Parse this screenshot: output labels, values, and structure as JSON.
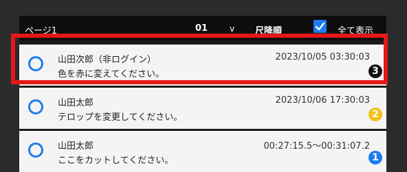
{
  "header": {
    "page_label": "ページ1",
    "page_number": "01",
    "dropdown_chevron": "v",
    "sort_label": "尺降順",
    "show_all_label": "全て表示",
    "show_all_checked": true
  },
  "comments": [
    {
      "name": "山田次郎（非ログイン）",
      "timestamp": "2023/10/05 03:30:03",
      "message": "色を赤に変えてください。",
      "badge": "3",
      "badge_color": "#111111",
      "badge_glyph": "❸"
    },
    {
      "name": "山田太郎",
      "timestamp": "2023/10/06 17:30:03",
      "message": "テロップを変更してください。",
      "badge": "2",
      "badge_color": "#f2c21a",
      "badge_glyph": "2"
    },
    {
      "name": "山田太郎",
      "timestamp": "00:27:15.5〜00:31:07.2",
      "message": "ここをカットしてください。",
      "badge": "1",
      "badge_color": "#1e7cf0",
      "badge_glyph": "1"
    }
  ],
  "colors": {
    "accent": "#1e7cf0",
    "highlight_frame": "#e5171a"
  },
  "icons": {
    "checkbox": "checkmark-icon",
    "row_marker": "circle-icon"
  }
}
